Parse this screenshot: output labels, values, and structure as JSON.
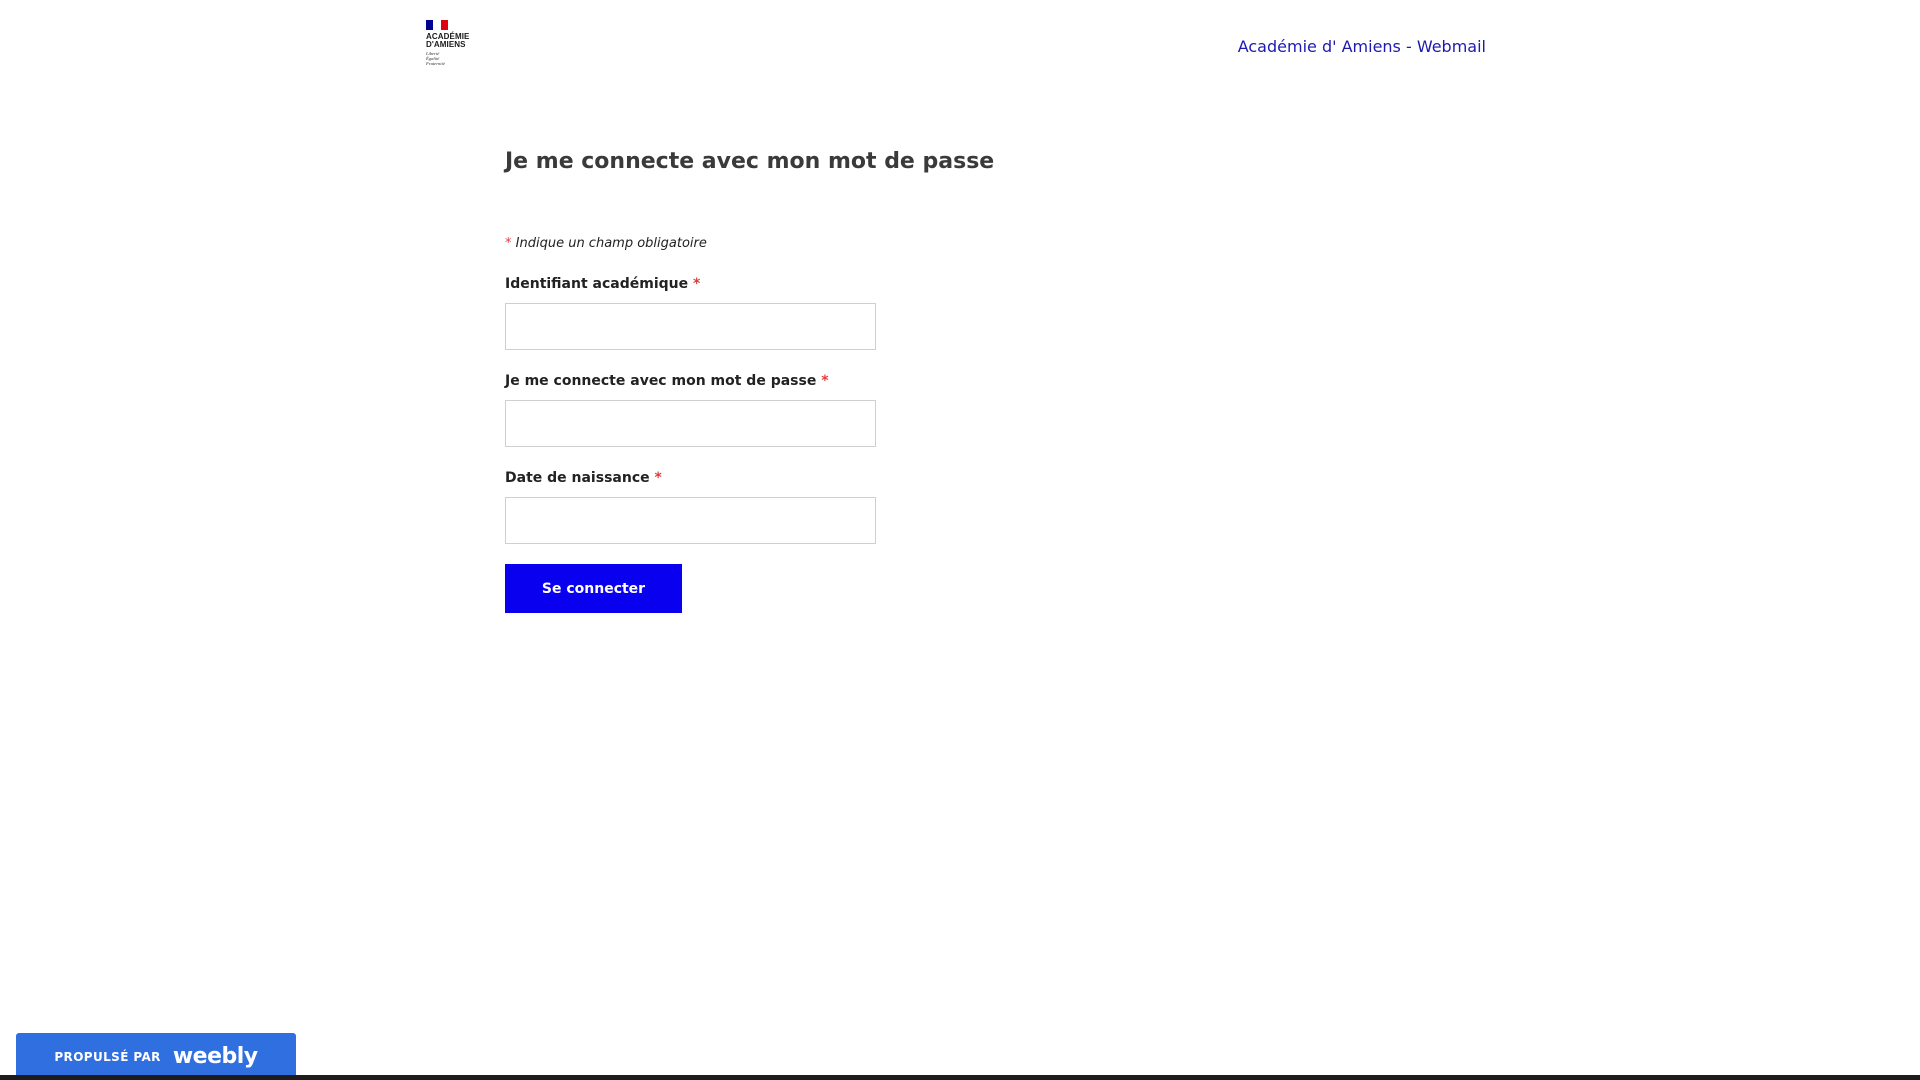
{
  "header": {
    "logo": {
      "name_lines": [
        "ACADÉMIE",
        "D'AMIENS"
      ],
      "motto_lines": [
        "Liberté",
        "Égalité",
        "Fraternité"
      ],
      "flag_colors": [
        "#000091",
        "#ffffff",
        "#e1000f"
      ]
    },
    "site_title": "Académie d' Amiens - Webmail"
  },
  "main": {
    "title": "Je me connecte avec mon mot de passe",
    "required_marker": "*",
    "required_note": "Indique un champ obligatoire",
    "fields": [
      {
        "label": "Identifiant académique",
        "value": ""
      },
      {
        "label": "Je me connecte avec mon mot de passe",
        "value": ""
      },
      {
        "label": "Date de naissance",
        "value": ""
      }
    ],
    "submit_label": "Se connecter"
  },
  "footer": {
    "badge_prefix": "PROPULSÉ PAR",
    "badge_brand": "weebly"
  },
  "colors": {
    "accent": "#0a00f0",
    "link": "#1e1ab0",
    "required": "#e23b3b",
    "badge": "#2f6fe0"
  }
}
